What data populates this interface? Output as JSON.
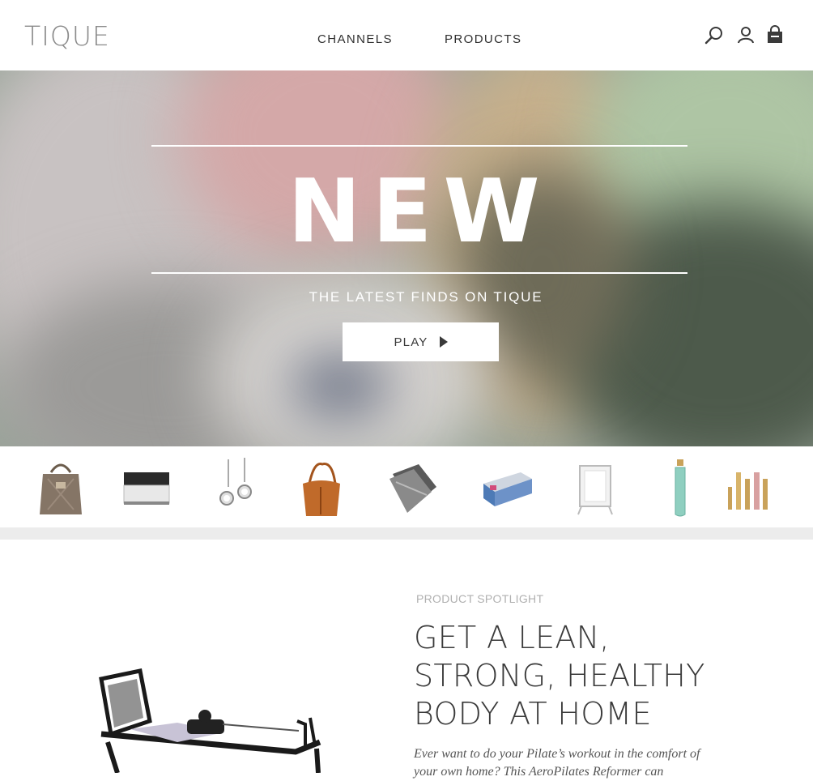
{
  "header": {
    "logo": "TIQUE",
    "nav": [
      {
        "label": "CHANNELS"
      },
      {
        "label": "PRODUCTS"
      }
    ],
    "icons": [
      "search-icon",
      "account-icon",
      "shopping-bag-icon"
    ]
  },
  "hero": {
    "title": "NEW",
    "subtitle": "THE LATEST FINDS ON TIQUE",
    "play_label": "PLAY"
  },
  "product_strip": {
    "items": [
      {
        "name": "tote-bag"
      },
      {
        "name": "face-cream-jar"
      },
      {
        "name": "drop-earrings"
      },
      {
        "name": "leather-hobo-bag"
      },
      {
        "name": "tea-towels"
      },
      {
        "name": "boxed-product"
      },
      {
        "name": "vanity-mirror"
      },
      {
        "name": "glass-water-bottle"
      },
      {
        "name": "lip-gloss-set"
      }
    ]
  },
  "spotlight": {
    "label": "PRODUCT SPOTLIGHT",
    "title": "GET A LEAN, STRONG, HEALTHY BODY AT HOME",
    "description": "Ever want to do your Pilate’s workout in the comfort of your own home? This AeroPilates Reformer can"
  },
  "colors": {
    "logo": "#8a8a8a",
    "text": "#3a3a3a",
    "label": "#b0b0b0",
    "band": "#ececec"
  }
}
